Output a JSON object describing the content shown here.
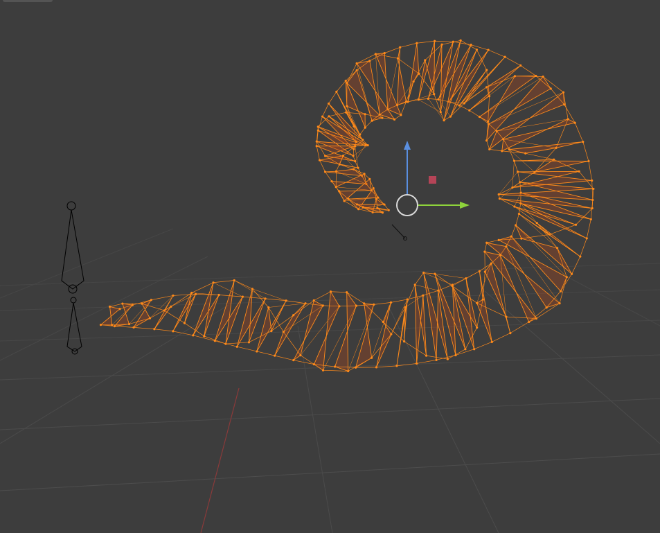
{
  "app": {
    "title": ""
  },
  "viewport": {
    "view": "3D Viewport",
    "shading": "wireframe",
    "background_color": "#3d3d3d",
    "grid_color": "#4a4a4a",
    "x_axis_color": "#8a3a3a"
  },
  "object": {
    "mode": "edit",
    "selection": "all",
    "wire_color": "#ff8a1a",
    "face_color": "#b0481c",
    "segments": 60
  },
  "armature": {
    "bones": 2,
    "color": "#000000"
  },
  "gizmo": {
    "type": "move",
    "x_axis_color": "#8ed33b",
    "z_axis_color": "#5a8fe0",
    "center_color": "#d9d9d9",
    "plane_handle_color": "#c2455a"
  }
}
